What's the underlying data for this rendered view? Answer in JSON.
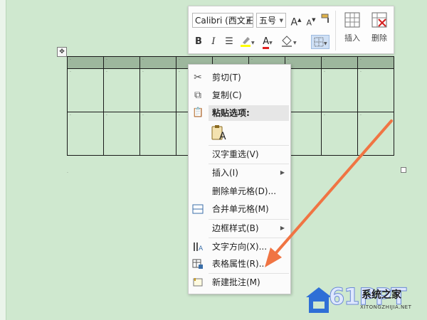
{
  "toolbar": {
    "font_name": "Calibri (西文正",
    "font_size": "五号",
    "grow_font": "A",
    "shrink_font": "A",
    "bold": "B",
    "italic": "I",
    "font_color_letter": "A",
    "insert_label": "插入",
    "delete_label": "删除"
  },
  "context_menu": {
    "cut": "剪切(T)",
    "copy": "复制(C)",
    "paste_options": "粘贴选项:",
    "paste_option_letter": "A",
    "reconvert": "汉字重选(V)",
    "insert": "插入(I)",
    "delete_cells": "删除单元格(D)...",
    "merge_cells": "合并单元格(M)",
    "border_styles": "边框样式(B)",
    "text_direction": "文字方向(X)...",
    "table_properties": "表格属性(R)...",
    "new_comment": "新建批注(M)"
  },
  "watermark": {
    "logo_text": "61PPT",
    "site_name": "系统之家",
    "url": "XITONGZHIJIA.NET"
  },
  "colors": {
    "page_background": "#cfe8cf",
    "selected_row": "#9db79d",
    "arrow": "#f07443",
    "menu_highlight": "#e6e6e6"
  }
}
